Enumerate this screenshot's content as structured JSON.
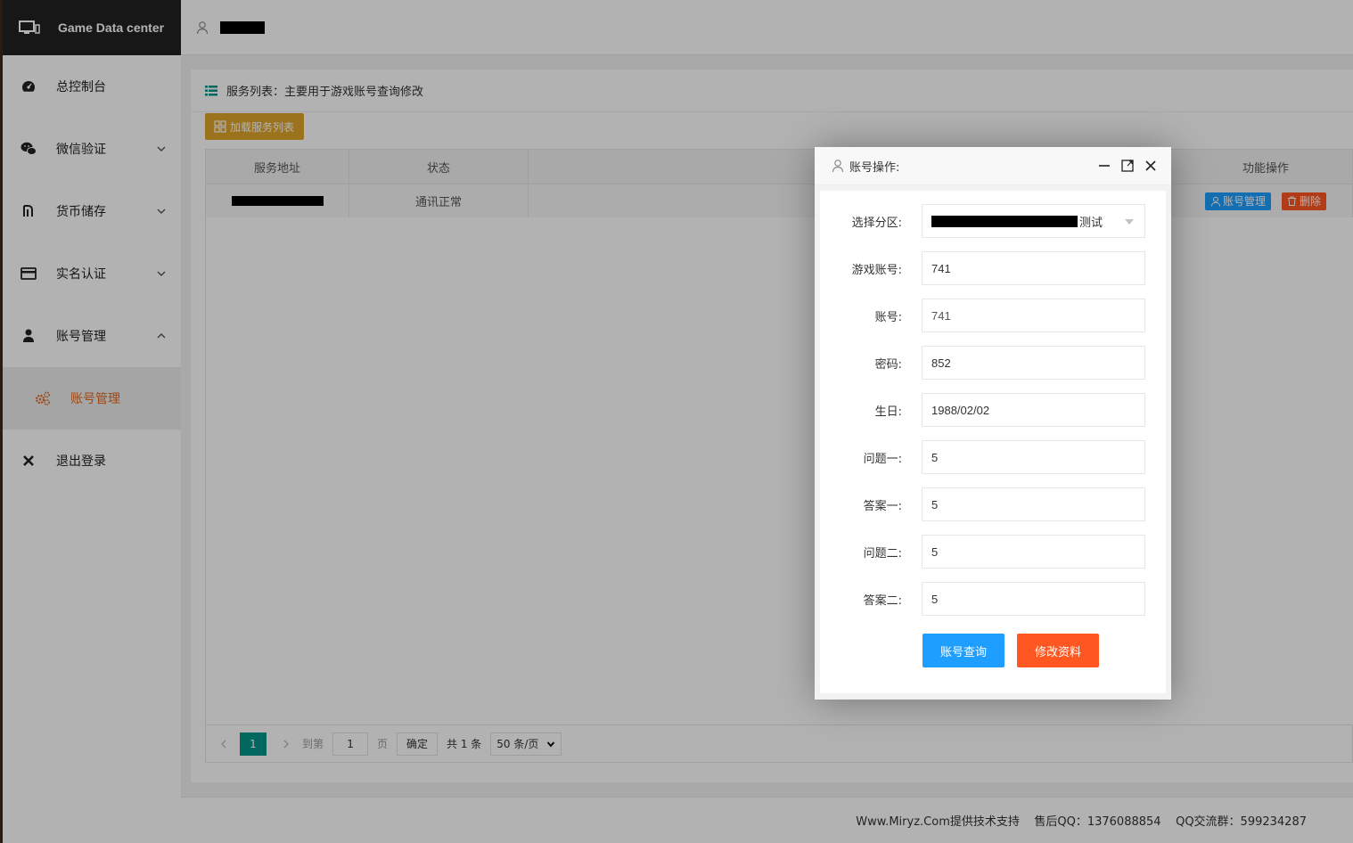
{
  "brand": {
    "title": "Game Data center"
  },
  "sidebar": {
    "items": [
      {
        "label": "总控制台",
        "icon": "dashboard-icon"
      },
      {
        "label": "微信验证",
        "icon": "wechat-icon"
      },
      {
        "label": "货币储存",
        "icon": "currency-icon"
      },
      {
        "label": "实名认证",
        "icon": "credit-card-icon"
      },
      {
        "label": "账号管理",
        "icon": "user-icon"
      }
    ],
    "sub_item": {
      "label": "账号管理",
      "icon": "gears-icon"
    },
    "logout": {
      "label": "退出登录",
      "icon": "close-icon"
    }
  },
  "card": {
    "title": "服务列表：主要用于游戏账号查询修改"
  },
  "toolbar": {
    "load_label": "加载服务列表"
  },
  "table": {
    "headers": {
      "address": "服务地址",
      "status": "状态",
      "ops": "功能操作"
    },
    "rows": [
      {
        "status": "通讯正常",
        "manage_label": "账号管理",
        "delete_label": "删除"
      }
    ]
  },
  "pager": {
    "current": "1",
    "goto_label": "到第",
    "goto_value": "1",
    "page_label": "页",
    "confirm_label": "确定",
    "total_label": "共 1 条",
    "page_size": "50 条/页"
  },
  "footer": {
    "text": "Www.Miryz.Com提供技术支持    售后QQ：1376088854    QQ交流群：599234287"
  },
  "modal": {
    "title": "账号操作:",
    "fields": [
      {
        "label": "选择分区:",
        "value": "测试"
      },
      {
        "label": "游戏账号:",
        "value": "741"
      },
      {
        "label": "账号:",
        "value": "741"
      },
      {
        "label": "密码:",
        "value": "852"
      },
      {
        "label": "生日:",
        "value": "1988/02/02"
      },
      {
        "label": "问题一:",
        "value": "5"
      },
      {
        "label": "答案一:",
        "value": "5"
      },
      {
        "label": "问题二:",
        "value": "5"
      },
      {
        "label": "答案二:",
        "value": "5"
      }
    ],
    "query_label": "账号查询",
    "modify_label": "修改资料"
  },
  "colors": {
    "accent_orange": "#e2681a",
    "load_button": "#e0a52a",
    "pager_active": "#009688",
    "query_button": "#1e9fff",
    "modify_button": "#ff5722"
  }
}
